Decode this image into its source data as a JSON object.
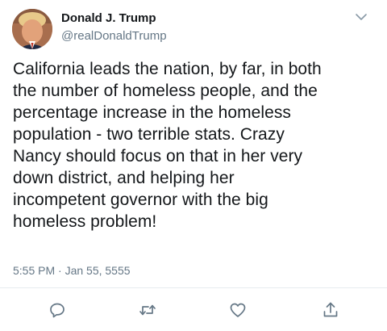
{
  "tweet": {
    "display_name": "Donald J. Trump",
    "handle": "@realDonaldTrump",
    "text": "California leads the nation, by far, in both\nthe number of homeless people, and the\npercentage increase in the homeless\npopulation - two terrible stats. Crazy\nNancy should focus on that in her very\ndown district, and helping her\nincompetent governor with the big\nhomeless problem!",
    "timestamp": "5:55 PM · Jan 55, 5555"
  },
  "icons": {
    "menu": "chevron-down-icon",
    "reply": "reply-icon",
    "retweet": "retweet-icon",
    "like": "heart-icon",
    "share": "share-icon"
  },
  "colors": {
    "text": "#14171a",
    "secondary": "#657786",
    "divider": "#e6ecf0",
    "icon": "#657786"
  }
}
